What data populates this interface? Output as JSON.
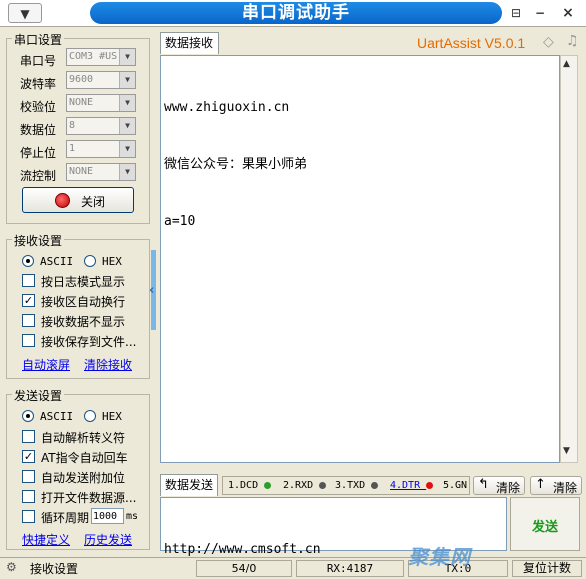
{
  "titlebar": {
    "menu_glyph": "▼",
    "title": "串口调试助手"
  },
  "brand": {
    "name": "UartAssist V5.0.1",
    "color": "#e56a00"
  },
  "serial_settings": {
    "title": "串口设置",
    "rows": [
      {
        "label": "串口号",
        "value": "COM3 #US"
      },
      {
        "label": "波特率",
        "value": "9600"
      },
      {
        "label": "校验位",
        "value": "NONE"
      },
      {
        "label": "数据位",
        "value": "8"
      },
      {
        "label": "停止位",
        "value": "1"
      },
      {
        "label": "流控制",
        "value": "NONE"
      }
    ],
    "close_button": "关闭"
  },
  "receive_settings": {
    "title": "接收设置",
    "mode_ascii": "ASCII",
    "mode_hex": "HEX",
    "options": [
      {
        "label": "按日志模式显示",
        "checked": false
      },
      {
        "label": "接收区自动换行",
        "checked": true
      },
      {
        "label": "接收数据不显示",
        "checked": false
      },
      {
        "label": "接收保存到文件...",
        "checked": false
      }
    ],
    "link_autoscroll": "自动滚屏",
    "link_clear": "清除接收"
  },
  "send_settings": {
    "title": "发送设置",
    "mode_ascii": "ASCII",
    "mode_hex": "HEX",
    "options": [
      {
        "label": "自动解析转义符",
        "checked": false
      },
      {
        "label": "AT指令自动回车",
        "checked": true
      },
      {
        "label": "自动发送附加位",
        "checked": false
      },
      {
        "label": "打开文件数据源...",
        "checked": false
      }
    ],
    "loop_label": "循环周期",
    "loop_value": "1000",
    "loop_unit": "ms",
    "link_shortcut": "快捷定义",
    "link_history": "历史发送"
  },
  "receive_area": {
    "tab": "数据接收",
    "lines": [
      "www.zhiguoxin.cn",
      "微信公众号：果果小师弟",
      "a=10"
    ]
  },
  "send_area": {
    "tab": "数据发送",
    "signals": [
      {
        "label": "1.DCD",
        "color": "#2a9d2a"
      },
      {
        "label": "2.RXD",
        "color": "#555555"
      },
      {
        "label": "3.TXD",
        "color": "#555555"
      },
      {
        "label": "4.DTR",
        "color": "#e01010"
      },
      {
        "label": "5.GN",
        "color": "#555555"
      }
    ],
    "clear1": "清除",
    "clear2": "清除",
    "text": "http://www.cmsoft.cn",
    "send_button": "发送",
    "send_color": "#1a9a1a"
  },
  "statusbar": {
    "label": "接收设置",
    "count": "54/0",
    "rx": "RX:4187",
    "tx": "TX:0",
    "reset": "复位计数"
  },
  "watermark": "聚集网"
}
